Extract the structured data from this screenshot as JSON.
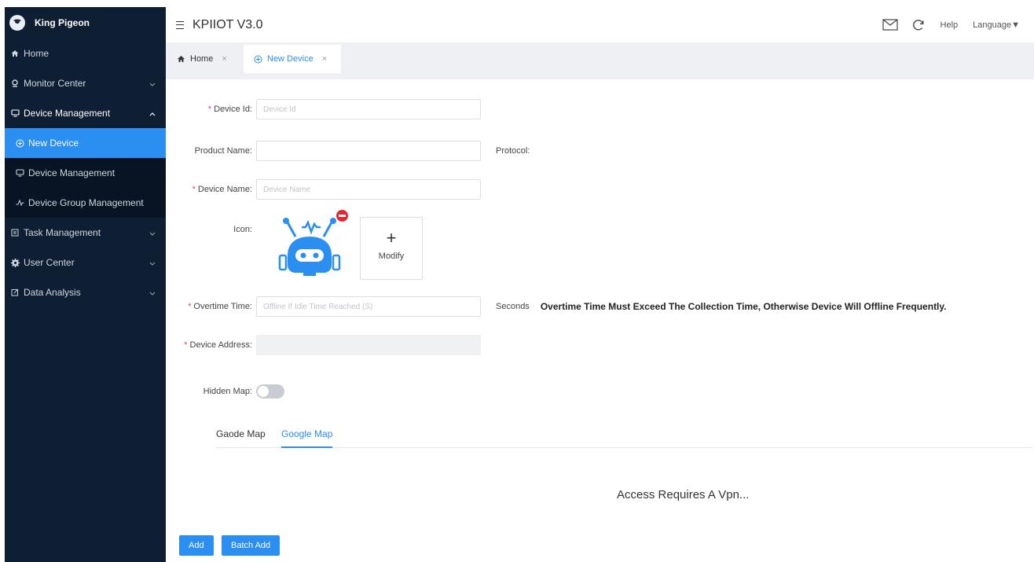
{
  "brand": {
    "name": "King Pigeon"
  },
  "sidebar": {
    "items": [
      {
        "label": "Home",
        "icon": "home-icon"
      },
      {
        "label": "Monitor Center",
        "icon": "location-pin-icon"
      },
      {
        "label": "Device Management",
        "icon": "monitor-icon"
      },
      {
        "label": "Task Management",
        "icon": "task-icon"
      },
      {
        "label": "User Center",
        "icon": "gear-icon"
      },
      {
        "label": "Data Analysis",
        "icon": "edit-icon"
      }
    ],
    "sub": [
      {
        "label": "New Device",
        "icon": "plus-circle-icon",
        "active": true
      },
      {
        "label": "Device Management",
        "icon": "monitor-icon"
      },
      {
        "label": "Device Group Management",
        "icon": "trend-icon"
      }
    ]
  },
  "header": {
    "title": "KPIIOT V3.0",
    "help": "Help",
    "language": "Language▼"
  },
  "tabs": [
    {
      "label": "Home",
      "close": "×"
    },
    {
      "label": "New Device",
      "close": "×"
    }
  ],
  "form": {
    "device_id": {
      "label": "Device Id:",
      "placeholder": "Device Id",
      "value": ""
    },
    "product_name": {
      "label": "Product Name:",
      "value": ""
    },
    "protocol": {
      "label": "Protocol:"
    },
    "device_name": {
      "label": "Device Name:",
      "placeholder": "Device Name",
      "value": ""
    },
    "icon": {
      "label": "Icon:",
      "modify": "Modify",
      "plus": "+"
    },
    "overtime": {
      "label": "Overtime Time:",
      "placeholder": "Offline If Idle Time Reached (S)",
      "unit": "Seconds",
      "warning": "Overtime Time Must Exceed The Collection Time, Otherwise Device Will Offline Frequently."
    },
    "device_address": {
      "label": "Device Address:",
      "value": ""
    },
    "hidden_map": {
      "label": "Hidden Map:",
      "on": false
    }
  },
  "map": {
    "tabs": [
      "Gaode Map",
      "Google Map"
    ],
    "active_tab": "Google Map",
    "message": "Access Requires A Vpn..."
  },
  "actions": {
    "add": "Add",
    "batch_add": "Batch Add"
  },
  "colors": {
    "sidebar_bg": "#0f1f33",
    "accent": "#2b8ff1",
    "required": "#e5484d"
  }
}
